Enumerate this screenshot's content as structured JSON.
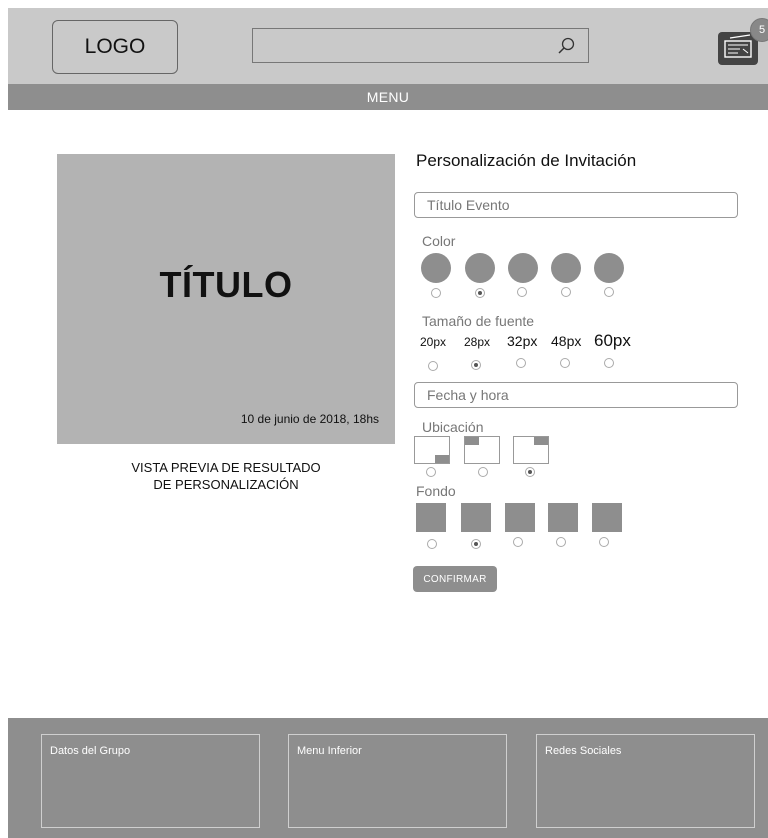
{
  "header": {
    "logo": "LOGO",
    "search": {
      "value": "",
      "placeholder": ""
    },
    "cart_count": "5"
  },
  "menu": {
    "label": "MENU"
  },
  "preview": {
    "title": "TÍTULO",
    "date": "10 de junio de 2018, 18hs",
    "caption_line1": "VISTA PREVIA DE RESULTADO",
    "caption_line2": "DE PERSONALIZACIÓN"
  },
  "form": {
    "heading": "Personalización de Invitación",
    "title_field": {
      "value": "",
      "placeholder": "Título Evento"
    },
    "color": {
      "label": "Color",
      "swatches": [
        "#8e8e8e",
        "#8e8e8e",
        "#8e8e8e",
        "#8e8e8e",
        "#8e8e8e"
      ],
      "selected_index": 1
    },
    "font_size": {
      "label": "Tamaño de fuente",
      "options": [
        "20px",
        "28px",
        "32px",
        "48px",
        "60px"
      ],
      "selected_index": 1
    },
    "datetime_field": {
      "value": "",
      "placeholder": "Fecha y hora"
    },
    "location": {
      "label": "Ubicación",
      "options": [
        "bottom-right",
        "top-left",
        "top-right"
      ],
      "selected_index": 2
    },
    "background": {
      "label": "Fondo",
      "swatches": [
        "#8e8e8e",
        "#8e8e8e",
        "#8e8e8e",
        "#8e8e8e",
        "#8e8e8e"
      ],
      "selected_index": 1
    },
    "confirm_label": "CONFIRMAR"
  },
  "footer": {
    "group": "Datos del Grupo",
    "menu": "Menu Inferior",
    "social": "Redes Sociales"
  },
  "colors": {
    "header_bg": "#c9c9c9",
    "accent_gray": "#8e8e8e",
    "preview_bg": "#b3b3b3"
  }
}
